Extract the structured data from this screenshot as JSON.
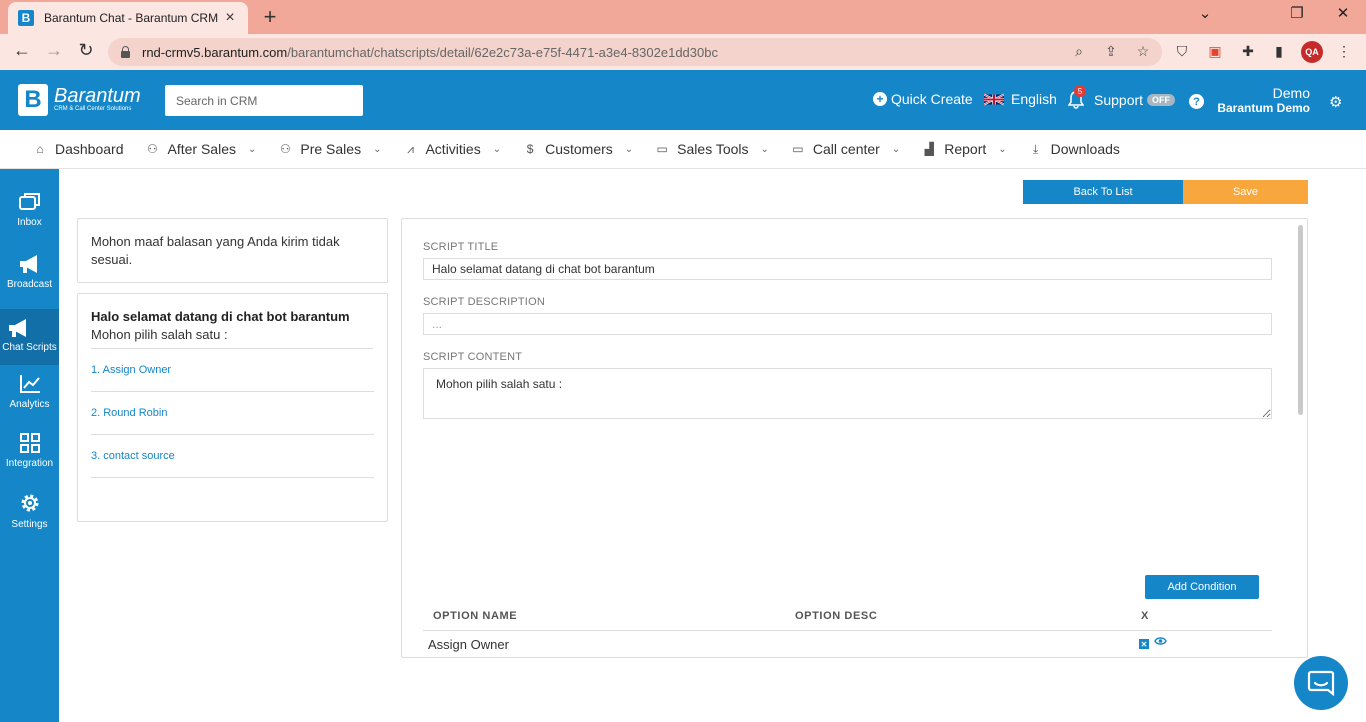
{
  "browser": {
    "tab_title": "Barantum Chat - Barantum CRM",
    "url_host": "rnd-crmv5.barantum.com",
    "url_path": "/barantumchat/chatscripts/detail/62e2c73a-e75f-4471-a3e4-8302e1dd30bc",
    "profile_initials": "QA"
  },
  "header": {
    "logo_name": "Barantum",
    "logo_sub": "CRM & Call Center Solutions",
    "search_placeholder": "Search in CRM",
    "quick_create": "Quick Create",
    "language": "English",
    "notif_count": "5",
    "support_label": "Support",
    "support_state": "OFF",
    "user_name": "Demo",
    "user_org": "Barantum Demo"
  },
  "menu": [
    {
      "label": "Dashboard",
      "icon": "home-icon",
      "dropdown": false
    },
    {
      "label": "After Sales",
      "icon": "users-icon",
      "dropdown": true
    },
    {
      "label": "Pre Sales",
      "icon": "users-icon",
      "dropdown": true
    },
    {
      "label": "Activities",
      "icon": "pulse-icon",
      "dropdown": true
    },
    {
      "label": "Customers",
      "icon": "dollar-icon",
      "dropdown": true
    },
    {
      "label": "Sales Tools",
      "icon": "folder-icon",
      "dropdown": true
    },
    {
      "label": "Call center",
      "icon": "folder-icon",
      "dropdown": true
    },
    {
      "label": "Report",
      "icon": "bar-chart-icon",
      "dropdown": true
    },
    {
      "label": "Downloads",
      "icon": "download-icon",
      "dropdown": false
    }
  ],
  "sidebar": {
    "items": [
      {
        "label": "Inbox",
        "icon": "inbox-icon"
      },
      {
        "label": "Broadcast",
        "icon": "megaphone-icon"
      },
      {
        "label": "Chat Scripts",
        "icon": "megaphone-icon",
        "active": true
      },
      {
        "label": "Analytics",
        "icon": "line-chart-icon"
      },
      {
        "label": "Integration",
        "icon": "grid-icon"
      },
      {
        "label": "Settings",
        "icon": "gear-icon"
      }
    ]
  },
  "actions": {
    "back_label": "Back To List",
    "save_label": "Save"
  },
  "preview": {
    "fallback_message": "Mohon maaf balasan yang Anda kirim tidak sesuai.",
    "script_title": "Halo selamat datang di chat bot barantum",
    "script_prompt": "Mohon pilih salah satu :",
    "options": [
      "1. Assign Owner",
      "2. Round Robin",
      "3. contact source"
    ]
  },
  "form": {
    "title_label": "SCRIPT TITLE",
    "title_value": "Halo selamat datang di chat bot barantum",
    "desc_label": "SCRIPT DESCRIPTION",
    "desc_placeholder": "...",
    "content_label": "SCRIPT CONTENT",
    "content_value": "Mohon pilih salah satu :",
    "add_condition_label": "Add Condition",
    "table": {
      "col_name": "OPTION NAME",
      "col_desc": "OPTION DESC",
      "col_x": "X",
      "rows": [
        {
          "name": "Assign Owner",
          "desc": ""
        }
      ]
    }
  },
  "colors": {
    "brand": "#1586c8",
    "save": "#f7a73b",
    "browser_tabbar": "#f1a899"
  }
}
